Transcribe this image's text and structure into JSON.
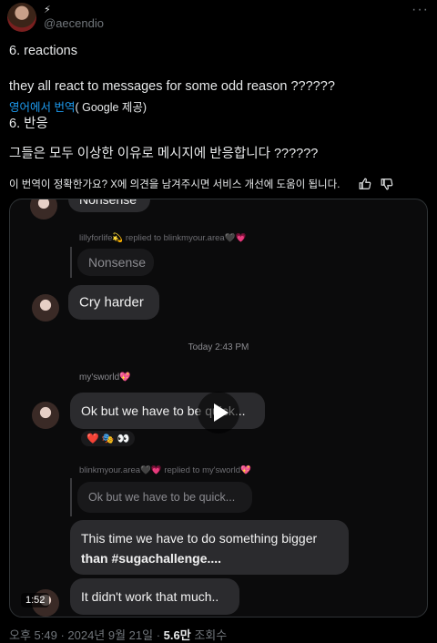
{
  "tweet": {
    "bolt": "⚡",
    "handle": "@aecendio",
    "line1": "6. reactions",
    "line2": "they all react to messages for some odd reason ??????",
    "translate_from": "영어에서 번역",
    "translate_by": "( Google 제공)",
    "line3": "6. 반응",
    "line4": "그들은 모두 이상한 이유로 메시지에 반응합니다 ??????",
    "feedback_question": "이 번역이 정확한가요? X에 의견을 남겨주시면 서비스 개선에 도움이 됩니다.",
    "footer_time": "오후 5:49 · 2024년 9월 21일 · ",
    "footer_views": "5.6만",
    "footer_views_label": " 조회수"
  },
  "video": {
    "duration": "1:52",
    "chat": {
      "top_bubble": "Nonsense",
      "reply1_header": "lillyforlife💫 replied to blinkmyour.area🖤💗",
      "reply1_quote": "Nonsense",
      "msg1": "Cry harder",
      "timestamp": "Today 2:43 PM",
      "user2": "my'sworld💖",
      "msg2": "Ok but we have to be quick...",
      "reactions": "❤️ 🎭 👀",
      "reply2_header": "blinkmyour.area🖤💗 replied to my'sworld💖",
      "reply2_quote": "Ok but we have to be quick...",
      "msg3_line1": "This time we have to do something bigger",
      "msg3_line2": "than #sugachallenge....",
      "msg4": "It didn't work that much.."
    }
  },
  "colors": {
    "link": "#1d9bf0",
    "muted": "#71767b",
    "bg": "#000000"
  }
}
